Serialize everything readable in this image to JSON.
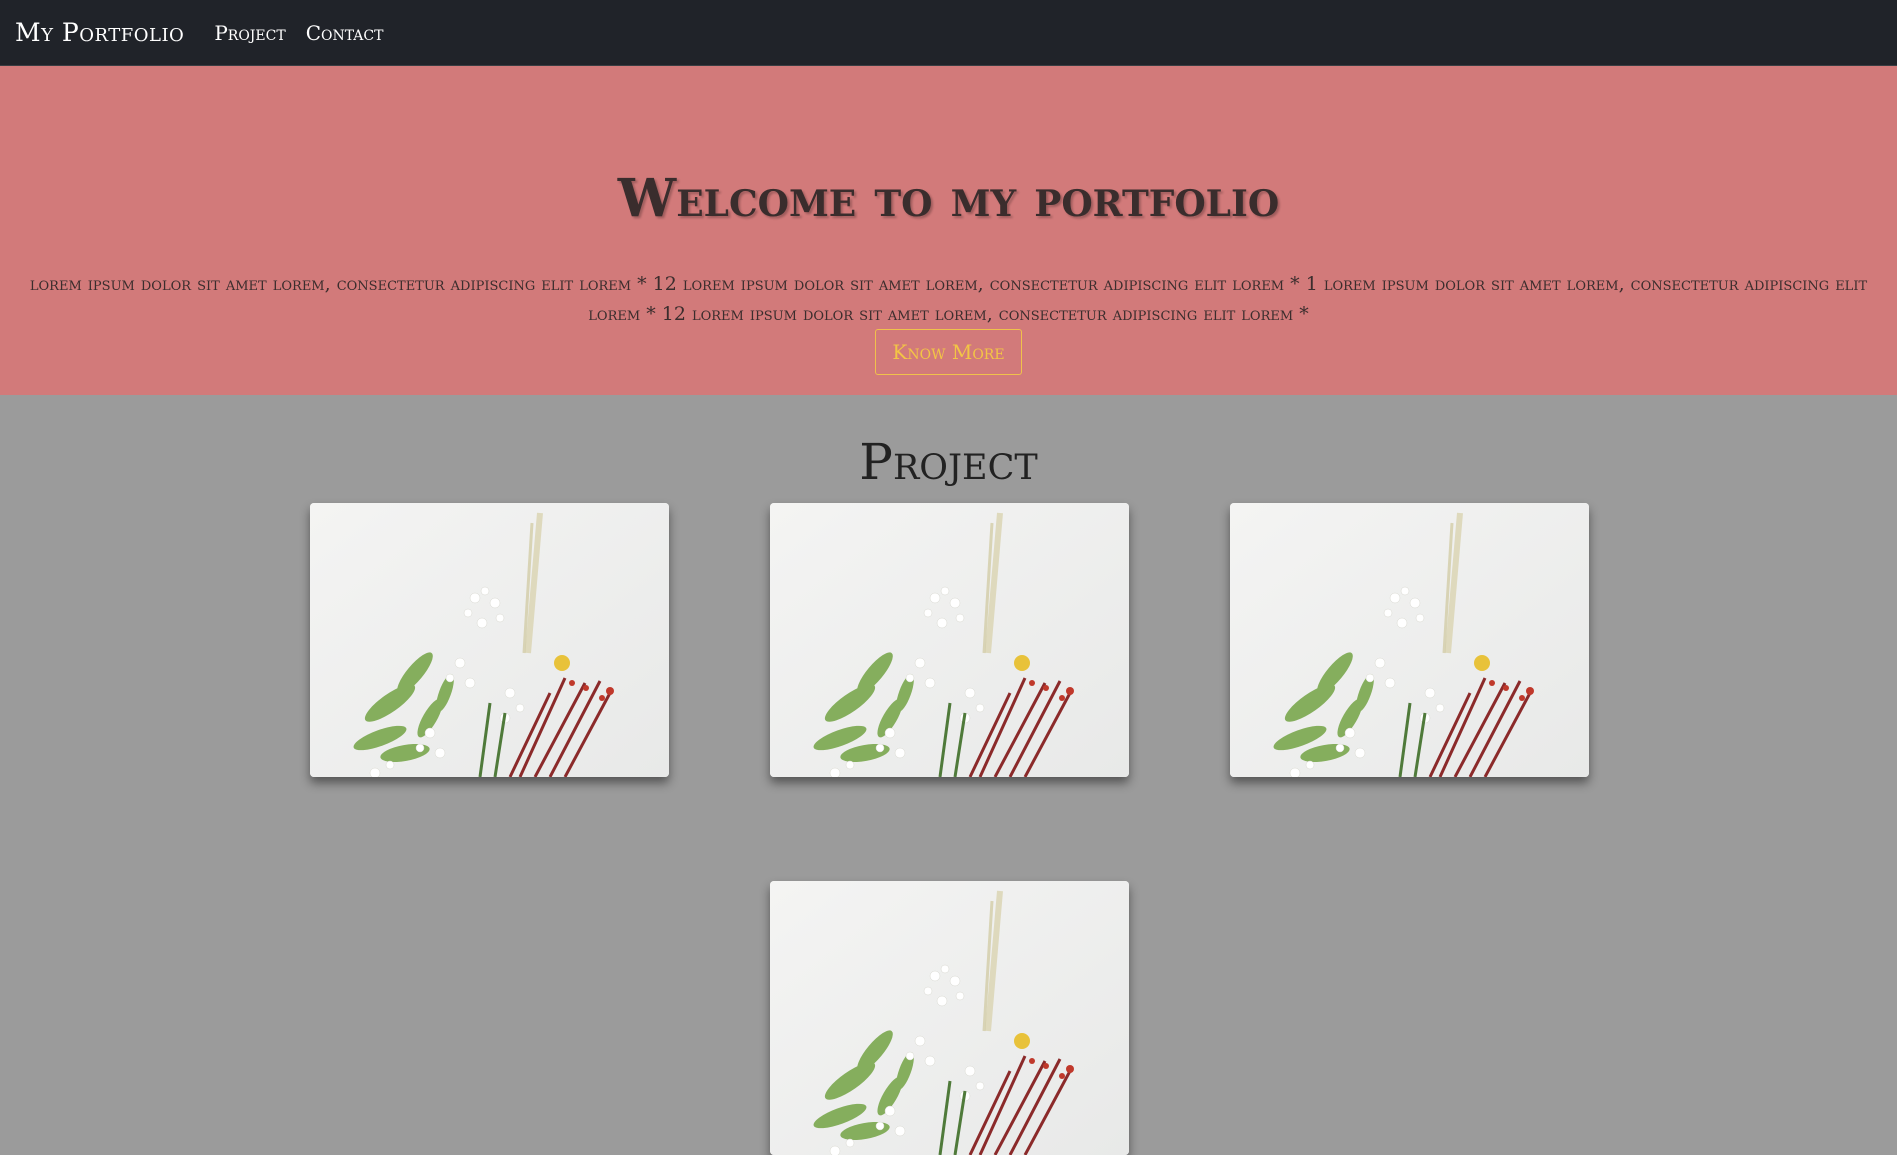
{
  "navbar": {
    "brand": "My Portfolio",
    "links": [
      "Project",
      "Contact"
    ]
  },
  "hero": {
    "title": "Welcome to my portfolio",
    "text": "lorem ipsum dolor sit amet lorem, consectetur adipiscing elit lorem * 12 lorem ipsum dolor sit amet lorem, consectetur adipiscing elit lorem * 1 lorem ipsum dolor sit amet lorem, consectetur adipiscing elit lorem * 12 lorem ipsum dolor sit amet lorem, consectetur adipiscing elit lorem *",
    "button": "Know More"
  },
  "projects": {
    "title": "Project",
    "cards": [
      {
        "image": "flower-bouquet-photo"
      },
      {
        "image": "flower-bouquet-photo"
      },
      {
        "image": "flower-bouquet-photo"
      },
      {
        "image": "flower-bouquet-photo"
      }
    ]
  },
  "colors": {
    "navbar_bg": "#202329",
    "hero_bg": "#d27a7a",
    "section_bg": "#9b9b9b",
    "button_accent": "#f3c545"
  }
}
